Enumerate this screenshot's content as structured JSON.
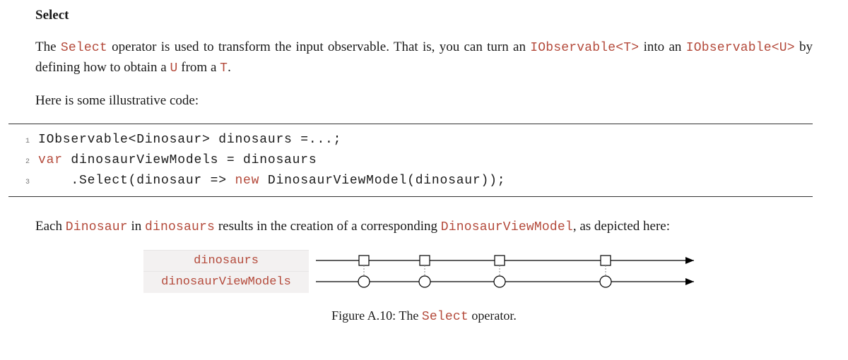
{
  "heading": "Select",
  "para1": {
    "t1": "The ",
    "c1": "Select",
    "t2": " operator is used to transform the input observable.  That is, you can turn an ",
    "c2": "IObservable<T>",
    "t3": " into an ",
    "c3": "IObservable<U>",
    "t4": " by defining how to obtain a ",
    "c4": "U",
    "t5": " from a ",
    "c5": "T",
    "t6": "."
  },
  "para2": "Here is some illustrative code:",
  "code": {
    "l1": {
      "n": "1",
      "a": "IObservable<Dinosaur> dinosaurs =...;"
    },
    "l2": {
      "n": "2",
      "k": "var",
      "a": " dinosaurViewModels = dinosaurs"
    },
    "l3": {
      "n": "3",
      "a": "    .Select(dinosaur => ",
      "k": "new",
      "b": " DinosaurViewModel(dinosaur));"
    }
  },
  "para3": {
    "t1": "Each ",
    "c1": "Dinosaur",
    "t2": " in ",
    "c2": "dinosaurs",
    "t3": " results in the creation of a corresponding ",
    "c3": "DinosaurViewModel",
    "t4": ", as depicted here:"
  },
  "marble": {
    "row1": "dinosaurs",
    "row2": "dinosaurViewModels"
  },
  "caption": {
    "t1": "Figure A.10: The ",
    "c1": "Select",
    "t2": " operator."
  },
  "chart_data": {
    "type": "marble-diagram",
    "streams": [
      {
        "name": "dinosaurs",
        "marker": "square",
        "events_x": [
          78,
          164,
          270,
          420
        ]
      },
      {
        "name": "dinosaurViewModels",
        "marker": "circle",
        "events_x": [
          78,
          164,
          270,
          420
        ]
      }
    ],
    "track_width": 560,
    "arrow_end": 545
  }
}
